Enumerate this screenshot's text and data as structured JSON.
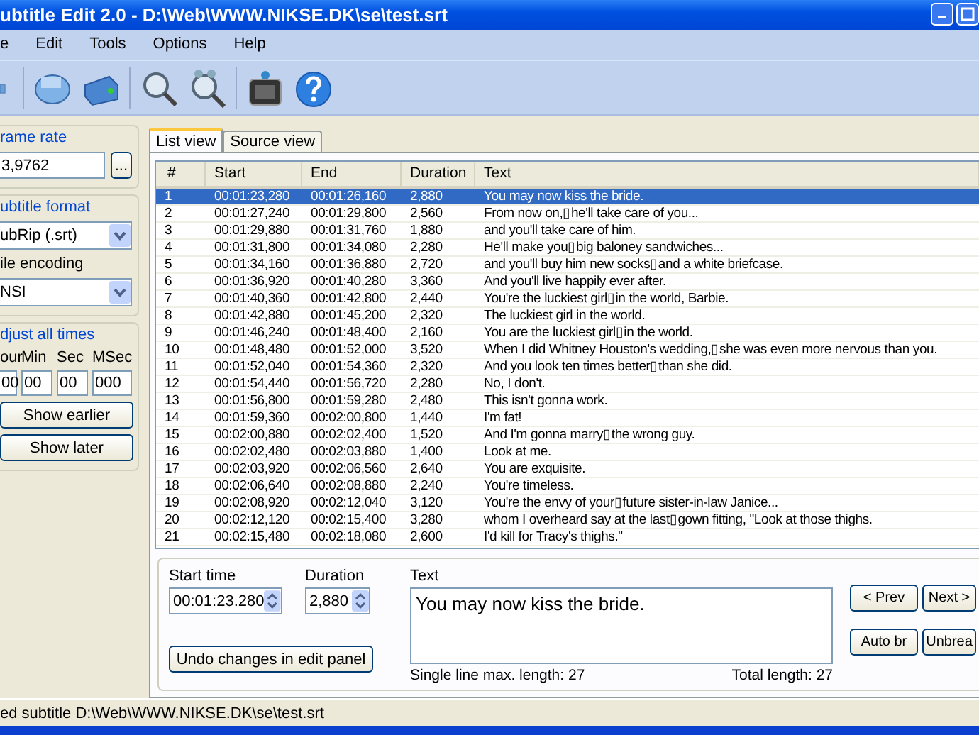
{
  "window": {
    "title": "ubtitle Edit 2.0 - D:\\Web\\WWW.NIKSE.DK\\se\\test.srt"
  },
  "menu": [
    "e",
    "Edit",
    "Tools",
    "Options",
    "Help"
  ],
  "sidebar": {
    "frame_rate": {
      "label": "rame rate",
      "value": "3,9762",
      "button": "..."
    },
    "format": {
      "label": "ubtitle format",
      "value": "ubRip (.srt)"
    },
    "encoding": {
      "label": "ile encoding",
      "value": "NSI"
    },
    "adjust": {
      "label": "djust all times",
      "fields": [
        {
          "label": "our",
          "value": "00"
        },
        {
          "label": "Min",
          "value": "00"
        },
        {
          "label": "Sec",
          "value": "00"
        },
        {
          "label": "MSec",
          "value": "000"
        }
      ],
      "buttons": [
        "Show earlier",
        "Show later"
      ]
    }
  },
  "tabs": [
    {
      "label": "List view",
      "selected": true
    },
    {
      "label": "Source view",
      "selected": false
    }
  ],
  "table": {
    "columns": [
      "#",
      "Start",
      "End",
      "Duration",
      "Text"
    ],
    "rows": [
      {
        "cells": [
          "1",
          "00:01:23,280",
          "00:01:26,160",
          "2,880",
          "You may now kiss the bride."
        ],
        "selected": true
      },
      {
        "cells": [
          "2",
          "00:01:27,240",
          "00:01:29,800",
          "2,560",
          "From now on,▯he'll take care of you..."
        ],
        "selected": false
      },
      {
        "cells": [
          "3",
          "00:01:29,880",
          "00:01:31,760",
          "1,880",
          "and you'll take care of him."
        ],
        "selected": false
      },
      {
        "cells": [
          "4",
          "00:01:31,800",
          "00:01:34,080",
          "2,280",
          "He'll make you▯big baloney sandwiches..."
        ],
        "selected": false
      },
      {
        "cells": [
          "5",
          "00:01:34,160",
          "00:01:36,880",
          "2,720",
          "and you'll buy him new socks▯and a white briefcase."
        ],
        "selected": false
      },
      {
        "cells": [
          "6",
          "00:01:36,920",
          "00:01:40,280",
          "3,360",
          "And you'll live happily ever after."
        ],
        "selected": false
      },
      {
        "cells": [
          "7",
          "00:01:40,360",
          "00:01:42,800",
          "2,440",
          "You're the luckiest girl▯in the world, Barbie."
        ],
        "selected": false
      },
      {
        "cells": [
          "8",
          "00:01:42,880",
          "00:01:45,200",
          "2,320",
          "The luckiest girl in the world."
        ],
        "selected": false
      },
      {
        "cells": [
          "9",
          "00:01:46,240",
          "00:01:48,400",
          "2,160",
          "You are the luckiest girl▯in the world."
        ],
        "selected": false
      },
      {
        "cells": [
          "10",
          "00:01:48,480",
          "00:01:52,000",
          "3,520",
          "When I did Whitney Houston's wedding,▯she was even more nervous than you."
        ],
        "selected": false
      },
      {
        "cells": [
          "11",
          "00:01:52,040",
          "00:01:54,360",
          "2,320",
          "And you look ten times better▯than she did."
        ],
        "selected": false
      },
      {
        "cells": [
          "12",
          "00:01:54,440",
          "00:01:56,720",
          "2,280",
          "No, I don't."
        ],
        "selected": false
      },
      {
        "cells": [
          "13",
          "00:01:56,800",
          "00:01:59,280",
          "2,480",
          "This isn't gonna work."
        ],
        "selected": false
      },
      {
        "cells": [
          "14",
          "00:01:59,360",
          "00:02:00,800",
          "1,440",
          "I'm fat!"
        ],
        "selected": false
      },
      {
        "cells": [
          "15",
          "00:02:00,880",
          "00:02:02,400",
          "1,520",
          "And I'm gonna marry▯the wrong guy."
        ],
        "selected": false
      },
      {
        "cells": [
          "16",
          "00:02:02,480",
          "00:02:03,880",
          "1,400",
          "Look at me."
        ],
        "selected": false
      },
      {
        "cells": [
          "17",
          "00:02:03,920",
          "00:02:06,560",
          "2,640",
          "You are exquisite."
        ],
        "selected": false
      },
      {
        "cells": [
          "18",
          "00:02:06,640",
          "00:02:08,880",
          "2,240",
          "You're timeless."
        ],
        "selected": false
      },
      {
        "cells": [
          "19",
          "00:02:08,920",
          "00:02:12,040",
          "3,120",
          "You're the envy of your▯future sister-in-law Janice..."
        ],
        "selected": false
      },
      {
        "cells": [
          "20",
          "00:02:12,120",
          "00:02:15,400",
          "3,280",
          "whom I overheard say at the last▯gown fitting, \"Look at those thighs."
        ],
        "selected": false
      },
      {
        "cells": [
          "21",
          "00:02:15,480",
          "00:02:18,080",
          "2,600",
          "I'd kill for Tracy's thighs.\""
        ],
        "selected": false
      }
    ]
  },
  "edit_panel": {
    "start_time": {
      "label": "Start time",
      "value": "00:01:23.280"
    },
    "duration": {
      "label": "Duration",
      "value": "2,880"
    },
    "undo_button": "Undo changes in edit panel",
    "text": {
      "label": "Text",
      "value": "You may now kiss the bride."
    },
    "single_line_length": "Single line max. length: 27",
    "total_length": "Total length: 27",
    "buttons": [
      "< Prev",
      "Next >",
      "Auto br",
      "Unbrea"
    ]
  },
  "status_bar": "ed subtitle D:\\Web\\WWW.NIKSE.DK\\se\\test.srt"
}
